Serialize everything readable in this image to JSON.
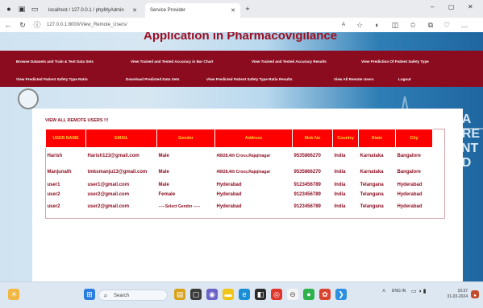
{
  "browser": {
    "tabs": [
      {
        "label": "localhost / 127.0.0.1 / phpMyAdmin"
      },
      {
        "label": "Service Provider"
      }
    ],
    "new_tab": "+",
    "url": "127.0.0.1:8000/View_Remote_Users/",
    "window_controls": [
      "–",
      "▢",
      "✕"
    ]
  },
  "app": {
    "title": "Application in Pharmacovigilance"
  },
  "nav": {
    "row1": [
      "Browse Datasets and Train & Test Data Sets",
      "View Trained and Tested Accuracy in Bar Chart",
      "View Trained and Tested Accuracy Results",
      "View Prediction Of Patient Safety Type"
    ],
    "row2": [
      "View Predicted Patient Safety Type Ratio",
      "Download Predicted Data Sets",
      "View Predicted Patient Safety Type Ratio Results",
      "View All Remote Users",
      "Logout"
    ]
  },
  "remote_users": {
    "title": "VIEW ALL REMOTE USERS !!!",
    "columns": [
      "USER NAME",
      "EMAIL",
      "Gender",
      "Address",
      "Mob No",
      "Country",
      "State",
      "City"
    ],
    "rows": [
      [
        "Harish",
        "Harish123@gmail.com",
        "Male",
        "#8928,4th Cross,Rajajinagar",
        "9535866270",
        "India",
        "Karnataka",
        "Bangalore"
      ],
      [
        "Manjunath",
        "tmksmanju13@gmail.com",
        "Male",
        "#8928,4th Cross,Rajajinagar",
        "9535866270",
        "India",
        "Karnataka",
        "Bangalore"
      ],
      [
        "user1",
        "user1@gmail.com",
        "Male",
        "Hyderabad",
        "9123456789",
        "India",
        "Telangana",
        "Hyderabad"
      ],
      [
        "user2",
        "user2@gmail.com",
        "Female",
        "Hyderabad",
        "9123456789",
        "India",
        "Telangana",
        "Hyderabad"
      ],
      [
        "user2",
        "user2@gmail.com",
        "-----Select Gender -----",
        "Hyderabad",
        "9123456789",
        "India",
        "Telangana",
        "Hyderabad"
      ]
    ]
  },
  "taskbar": {
    "search_placeholder": "Search",
    "tray_lang": "ENG IN",
    "time": "10:37",
    "date": "31-03-2024"
  }
}
